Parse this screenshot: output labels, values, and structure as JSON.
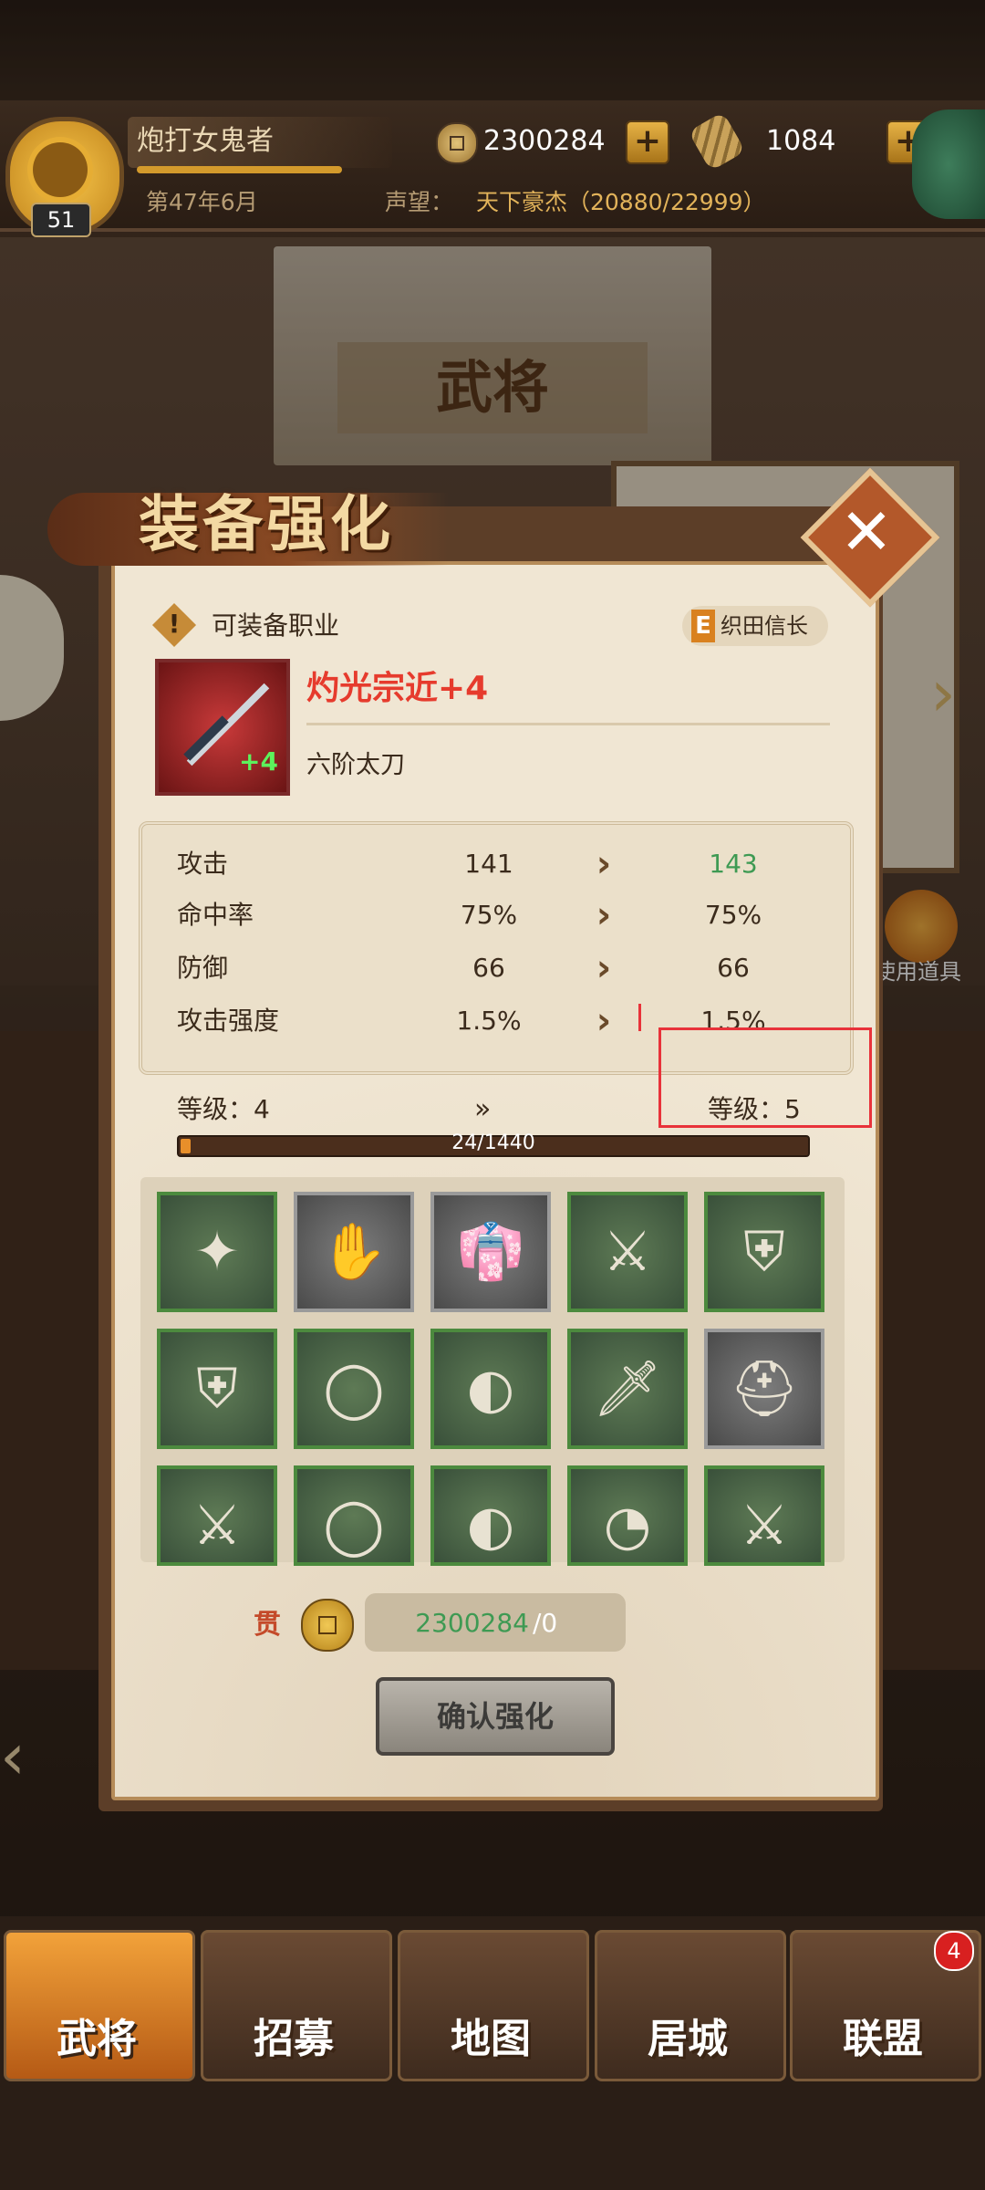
{
  "hud": {
    "player_name": "炮打女鬼者",
    "level": "51",
    "gold": "2300284",
    "hero_currency": "1084",
    "date": "第47年6月",
    "fame_label": "声望：",
    "fame_value": "天下豪杰（20880/22999）"
  },
  "background": {
    "title": "武将",
    "tool_label": "使用道具"
  },
  "modal": {
    "title": "装备强化",
    "job_label": "可装备职业",
    "job_tag_letter": "E",
    "job_tag_name": "织田信长",
    "item_name": "灼光宗近+4",
    "item_level": "+4",
    "item_type": "六阶太刀",
    "stats": [
      {
        "label": "攻击",
        "current": "141",
        "next": "143",
        "next_color": "#3e9a53"
      },
      {
        "label": "命中率",
        "current": "75%",
        "next": "75%",
        "next_color": "#3b2b1c"
      },
      {
        "label": "防御",
        "current": "66",
        "next": "66",
        "next_color": "#3b2b1c"
      },
      {
        "label": "攻击强度",
        "current": "1.5%",
        "next": "1.5%",
        "next_color": "#3b2b1c"
      }
    ],
    "level_current": "等级：4",
    "level_arrows": "»",
    "level_next": "等级：5",
    "progress_text": "24/1440",
    "progress_fraction": 0.0167,
    "materials": [
      {
        "name": "star-crystal",
        "border": "green"
      },
      {
        "name": "gauntlet",
        "border": "gray"
      },
      {
        "name": "robe",
        "border": "gray"
      },
      {
        "name": "katana",
        "border": "green"
      },
      {
        "name": "red-armor",
        "border": "green"
      },
      {
        "name": "pink-armor",
        "border": "green"
      },
      {
        "name": "headband",
        "border": "green"
      },
      {
        "name": "sandals",
        "border": "green"
      },
      {
        "name": "dagger",
        "border": "green"
      },
      {
        "name": "helmet",
        "border": "gray"
      },
      {
        "name": "sword",
        "border": "green"
      },
      {
        "name": "headband",
        "border": "green"
      },
      {
        "name": "sandals",
        "border": "green"
      },
      {
        "name": "fan",
        "border": "green"
      },
      {
        "name": "katana",
        "border": "green"
      }
    ],
    "cost_label": "贯",
    "cost_have": "2300284",
    "cost_need": "/0",
    "confirm_label": "确认强化"
  },
  "nav": {
    "items": [
      {
        "label": "武将",
        "active": true
      },
      {
        "label": "招募",
        "active": false
      },
      {
        "label": "地图",
        "active": false
      },
      {
        "label": "居城",
        "active": false
      },
      {
        "label": "联盟",
        "active": false
      }
    ],
    "badge": "4"
  },
  "colors": {
    "annotation": "#e8323a",
    "item_name": "#e63b2d",
    "nav_active": "#f2a23a"
  }
}
